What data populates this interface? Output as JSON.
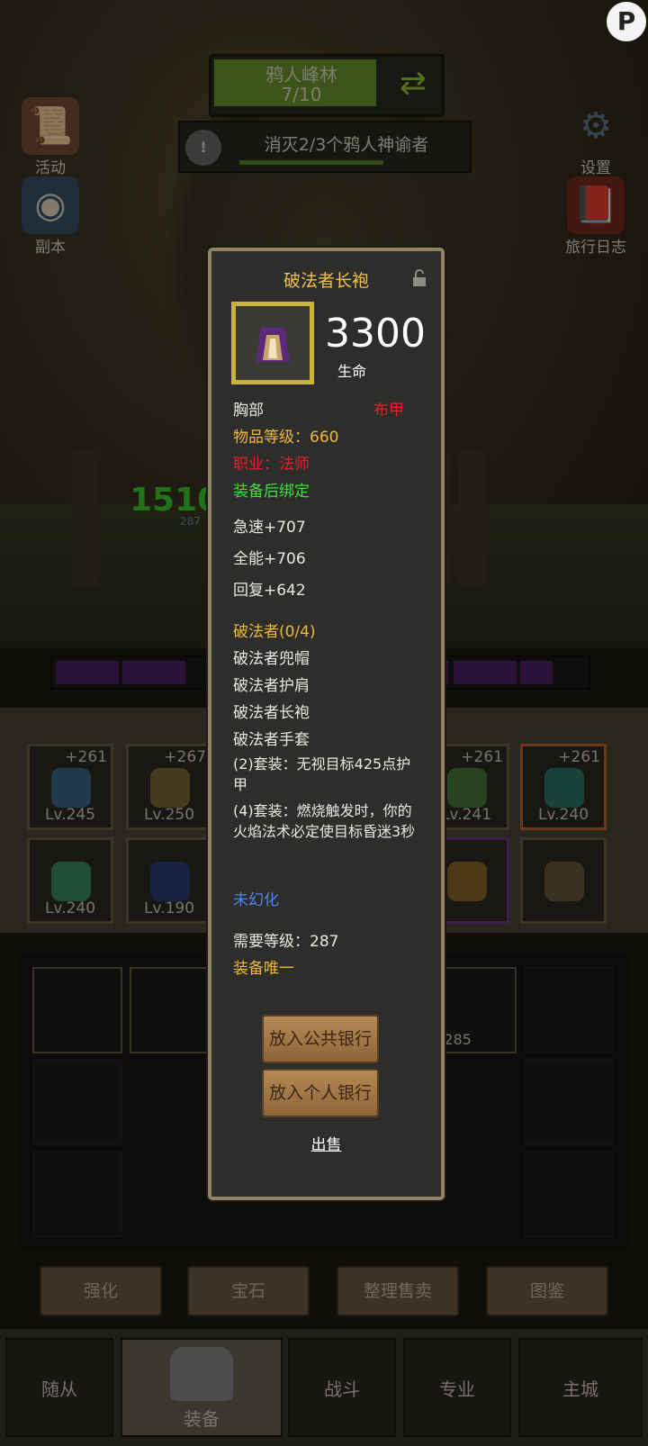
{
  "quest": {
    "name": "鸦人峰林",
    "count": "7/10"
  },
  "task": {
    "text": "消灭2/3个鸦人神谕者"
  },
  "side": {
    "activity": "活动",
    "dungeon": "副本",
    "settings": "设置",
    "journal": "旅行日志"
  },
  "damage": {
    "big": "1510",
    "small": "287"
  },
  "item": {
    "name": "破法者长袍",
    "primary_value": "3300",
    "primary_label": "生命",
    "slot": "胸部",
    "armor_type": "布甲",
    "item_level": "物品等级：660",
    "class_req": "职业：法师",
    "bind": "装备后绑定",
    "stats": [
      "急速+707",
      "全能+706",
      "回复+642"
    ],
    "set_name": "破法者(0/4)",
    "set_items": [
      "破法者兜帽",
      "破法者护肩",
      "破法者长袍",
      "破法者手套"
    ],
    "set_bonus_2": "(2)套装：无视目标425点护甲",
    "set_bonus_4": "(4)套装：燃烧触发时，你的火焰法术必定使目标昏迷3秒",
    "transmog": "未幻化",
    "req_level": "需要等级：287",
    "unique": "装备唯一"
  },
  "actions": {
    "public_bank": "放入公共银行",
    "personal_bank": "放入个人银行",
    "sell": "出售"
  },
  "equip_slots": [
    {
      "plus": "+261",
      "lv": "Lv.245"
    },
    {
      "plus": "+267",
      "lv": "Lv.250"
    },
    {
      "plus": "+261",
      "lv": "Lv.241"
    },
    {
      "plus": "+261",
      "lv": "Lv.240"
    },
    {
      "plus": "",
      "lv": "Lv.240"
    },
    {
      "plus": "",
      "lv": "Lv.190"
    }
  ],
  "bag": {
    "lv_285": "v.285"
  },
  "tabs": {
    "enhance": "强化",
    "gem": "宝石",
    "sort_sell": "整理售卖",
    "codex": "图鉴"
  },
  "nav": {
    "follower": "随从",
    "equipment": "装备",
    "battle": "战斗",
    "profession": "专业",
    "city": "主城"
  },
  "corner_logo": "P"
}
